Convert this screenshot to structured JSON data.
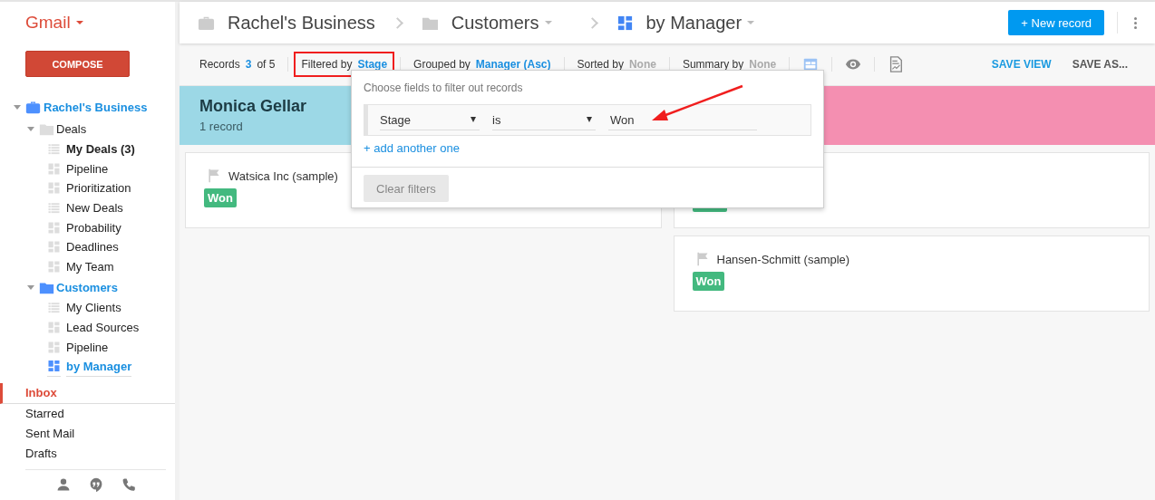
{
  "sidebar": {
    "app_title": "Gmail",
    "compose": "COMPOSE",
    "tree": [
      {
        "label": "Rachel's Business",
        "kind": "business",
        "expanded": true,
        "selected": false,
        "children": [
          {
            "label": "Deals",
            "kind": "folder",
            "expanded": true,
            "selected": false,
            "children": [
              {
                "label": "My Deals (3)",
                "kind": "list",
                "bold": true,
                "selected": false
              },
              {
                "label": "Pipeline",
                "kind": "grid",
                "selected": false
              },
              {
                "label": "Prioritization",
                "kind": "grid",
                "selected": false
              },
              {
                "label": "New Deals",
                "kind": "list",
                "selected": false
              },
              {
                "label": "Probability",
                "kind": "grid",
                "selected": false
              },
              {
                "label": "Deadlines",
                "kind": "grid",
                "selected": false
              },
              {
                "label": "My Team",
                "kind": "grid",
                "selected": false
              }
            ]
          },
          {
            "label": "Customers",
            "kind": "folder-active",
            "expanded": true,
            "selected": false,
            "children": [
              {
                "label": "My Clients",
                "kind": "list",
                "selected": false
              },
              {
                "label": "Lead Sources",
                "kind": "grid",
                "selected": false
              },
              {
                "label": "Pipeline",
                "kind": "grid",
                "selected": false
              },
              {
                "label": "by Manager",
                "kind": "grid",
                "selected": true
              }
            ]
          }
        ]
      }
    ],
    "mail": [
      {
        "label": "Inbox",
        "selected": true
      },
      {
        "label": "Starred",
        "selected": false
      },
      {
        "label": "Sent Mail",
        "selected": false
      },
      {
        "label": "Drafts",
        "selected": false
      }
    ]
  },
  "header": {
    "breadcrumbs": [
      {
        "label": "Rachel's Business",
        "kind": "business",
        "dropdown": false
      },
      {
        "label": "Customers",
        "kind": "folder",
        "dropdown": true
      },
      {
        "label": "by Manager",
        "kind": "grid",
        "dropdown": true
      }
    ],
    "new_record": "+ New record"
  },
  "toolbar": {
    "items": [
      {
        "label": "Records",
        "value": "3",
        "suffix": "of 5",
        "muted": false
      },
      {
        "label": "Filtered by",
        "value": "Stage",
        "muted": false
      },
      {
        "label": "Grouped by",
        "value": "Manager (Asc)",
        "muted": false
      },
      {
        "label": "Sorted by",
        "value": "None",
        "muted": true
      },
      {
        "label": "Summary by",
        "value": "None",
        "muted": true
      }
    ],
    "save_view": "SAVE VIEW",
    "save_as": "SAVE AS..."
  },
  "board": {
    "columns": [
      {
        "title": "Monica Gellar",
        "count": "1 record",
        "color": "#9cd8e6",
        "cards": [
          {
            "kind": "full",
            "name": "Watsica Inc (sample)",
            "tag": "Won"
          }
        ]
      },
      {
        "color": "#f48fb1",
        "cards": [
          {
            "kind": "covered"
          },
          {
            "kind": "full",
            "name": "Hansen-Schmitt (sample)",
            "tag": "Won"
          }
        ]
      }
    ]
  },
  "filter_popover": {
    "heading": "Choose fields to filter out records",
    "field": "Stage",
    "operator": "is",
    "value": "Won",
    "add_link": "+ add another one",
    "clear_button": "Clear filters"
  },
  "annotations": {
    "highlight_box": true,
    "arrow": true
  }
}
